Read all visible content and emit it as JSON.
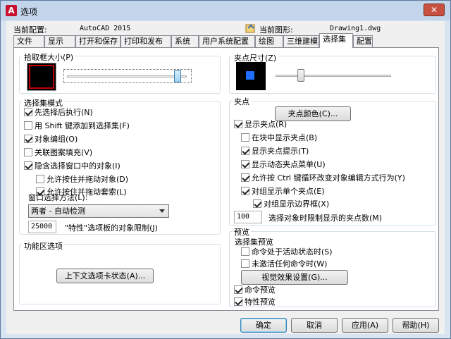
{
  "window": {
    "title": "选项",
    "close": "✕",
    "logo": "A"
  },
  "header": {
    "profile_label": "当前配置:",
    "profile_value": "AutoCAD 2015",
    "drawing_label": "当前图形:",
    "drawing_value": "Drawing1.dwg"
  },
  "tabs": [
    "文件",
    "显示",
    "打开和保存",
    "打印和发布",
    "系统",
    "用户系统配置",
    "绘图",
    "三维建模",
    "选择集",
    "配置"
  ],
  "active_tab": "选择集",
  "pickbox": {
    "title": "拾取框大小(P)",
    "level": 0.95
  },
  "selection_modes": {
    "title": "选择集模式",
    "items": [
      {
        "label": "先选择后执行(N)",
        "checked": true
      },
      {
        "label": "用 Shift 键添加到选择集(F)",
        "checked": false
      },
      {
        "label": "对象编组(O)",
        "checked": true
      },
      {
        "label": "关联图案填充(V)",
        "checked": false
      },
      {
        "label": "隐含选择窗口中的对象(I)",
        "checked": true
      },
      {
        "label": "允许按住并拖动对象(D)",
        "checked": false
      },
      {
        "label": "允许按住并拖动套索(L)",
        "checked": true
      }
    ],
    "window_method_label": "窗口选择方法(L):",
    "window_method_value": "两者 - 自动检测",
    "limit_value": "25000",
    "limit_label": "\"特性\"选项板的对象限制(J)"
  },
  "ribbon": {
    "title": "功能区选项",
    "button": "上下文选项卡状态(A)..."
  },
  "grip_size": {
    "title": "夹点尺寸(Z)",
    "level": 0.2
  },
  "grips": {
    "title": "夹点",
    "color_button": "夹点颜色(C)...",
    "items": [
      {
        "label": "显示夹点(R)",
        "checked": true
      },
      {
        "label": "在块中显示夹点(B)",
        "checked": false
      },
      {
        "label": "显示夹点提示(T)",
        "checked": true
      },
      {
        "label": "显示动态夹点菜单(U)",
        "checked": true
      },
      {
        "label": "允许按 Ctrl 键循环改变对象编辑方式行为(Y)",
        "checked": true
      },
      {
        "label": "对组显示单个夹点(E)",
        "checked": true
      },
      {
        "label": "对组显示边界框(X)",
        "checked": true
      }
    ],
    "limit_value": "100",
    "limit_label": "选择对象时限制显示的夹点数(M)"
  },
  "preview": {
    "title": "预览",
    "subtitle": "选择集预览",
    "items": [
      {
        "label": "命令处于活动状态时(S)",
        "checked": false
      },
      {
        "label": "未激活任何命令时(W)",
        "checked": false
      }
    ],
    "effects_button": "视觉效果设置(G)...",
    "items2": [
      {
        "label": "命令预览",
        "checked": true
      },
      {
        "label": "特性预览",
        "checked": true
      }
    ]
  },
  "footer": {
    "ok": "确定",
    "cancel": "取消",
    "apply": "应用(A)",
    "help": "帮助(H)"
  },
  "colors": {
    "grip_preview": "#1f6fff",
    "pickbox_border": "#c00000",
    "title_bar": "#c3d5ea"
  }
}
